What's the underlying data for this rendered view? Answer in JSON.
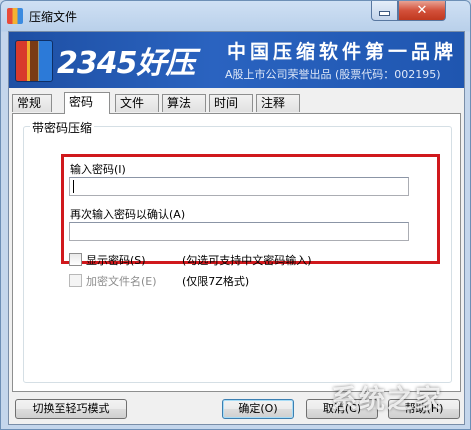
{
  "window": {
    "title": "压缩文件",
    "close_glyph": "✕"
  },
  "banner": {
    "brand": "2345好压",
    "slogan": "中国压缩软件第一品牌",
    "subline": "A股上市公司荣誉出品 (股票代码：002195)"
  },
  "tabs": [
    {
      "label": "常规",
      "active": false
    },
    {
      "label": "密码",
      "active": true
    },
    {
      "label": "文件",
      "active": false
    },
    {
      "label": "算法",
      "active": false
    },
    {
      "label": "时间",
      "active": false
    },
    {
      "label": "注释",
      "active": false
    }
  ],
  "password_group": {
    "title": "带密码压缩",
    "password_label": "输入密码(I)",
    "password_value": "",
    "confirm_label": "再次输入密码以确认(A)",
    "confirm_value": ""
  },
  "options": {
    "show_password_label": "显示密码(S)",
    "show_password_note": "(勾选可支持中文密码输入)",
    "encrypt_filenames_label": "加密文件名(E)",
    "encrypt_filenames_note": "(仅限7Z格式)"
  },
  "buttons": {
    "switch_mode": "切换至轻巧模式",
    "ok": "确定(O)",
    "cancel": "取消(C)",
    "help": "帮助(H)"
  },
  "watermark": "系统之家",
  "colors": {
    "highlight_frame": "#d0181c",
    "banner_blue": "#2a63c0"
  }
}
